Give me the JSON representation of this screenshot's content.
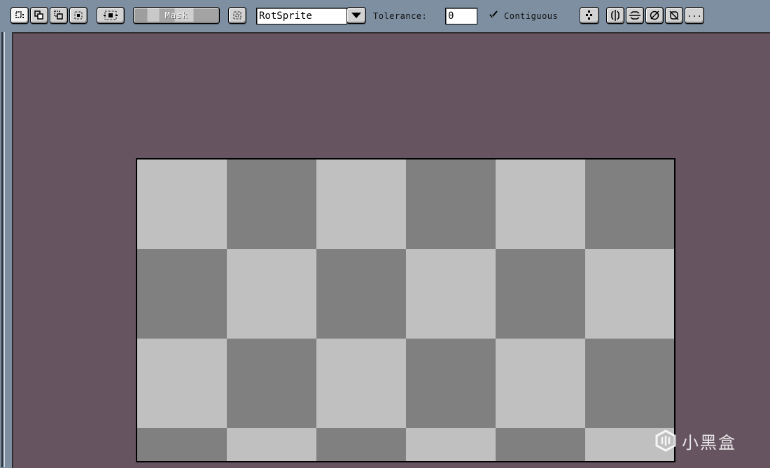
{
  "toolbar": {
    "mask_label": "Mask",
    "rotation_algorithm": "RotSprite",
    "tolerance_label": "Tolerance:",
    "tolerance_value": "0",
    "contiguous_label": "Contiguous",
    "contiguous_checked": true,
    "more_label": "..."
  },
  "icons": [
    "replace-selection-icon",
    "add-selection-icon",
    "subtract-selection-icon",
    "intersect-selection-icon",
    "pivot-icon",
    "transparent-color-icon",
    "chevron-down-icon",
    "brush-mode-icon",
    "symmetry-icon",
    "more-icon"
  ],
  "canvas": {
    "background_color": "#665560",
    "checker_dark": "#808080",
    "checker_light": "#c0c0c0"
  },
  "watermark": {
    "text": "小黑盒"
  }
}
